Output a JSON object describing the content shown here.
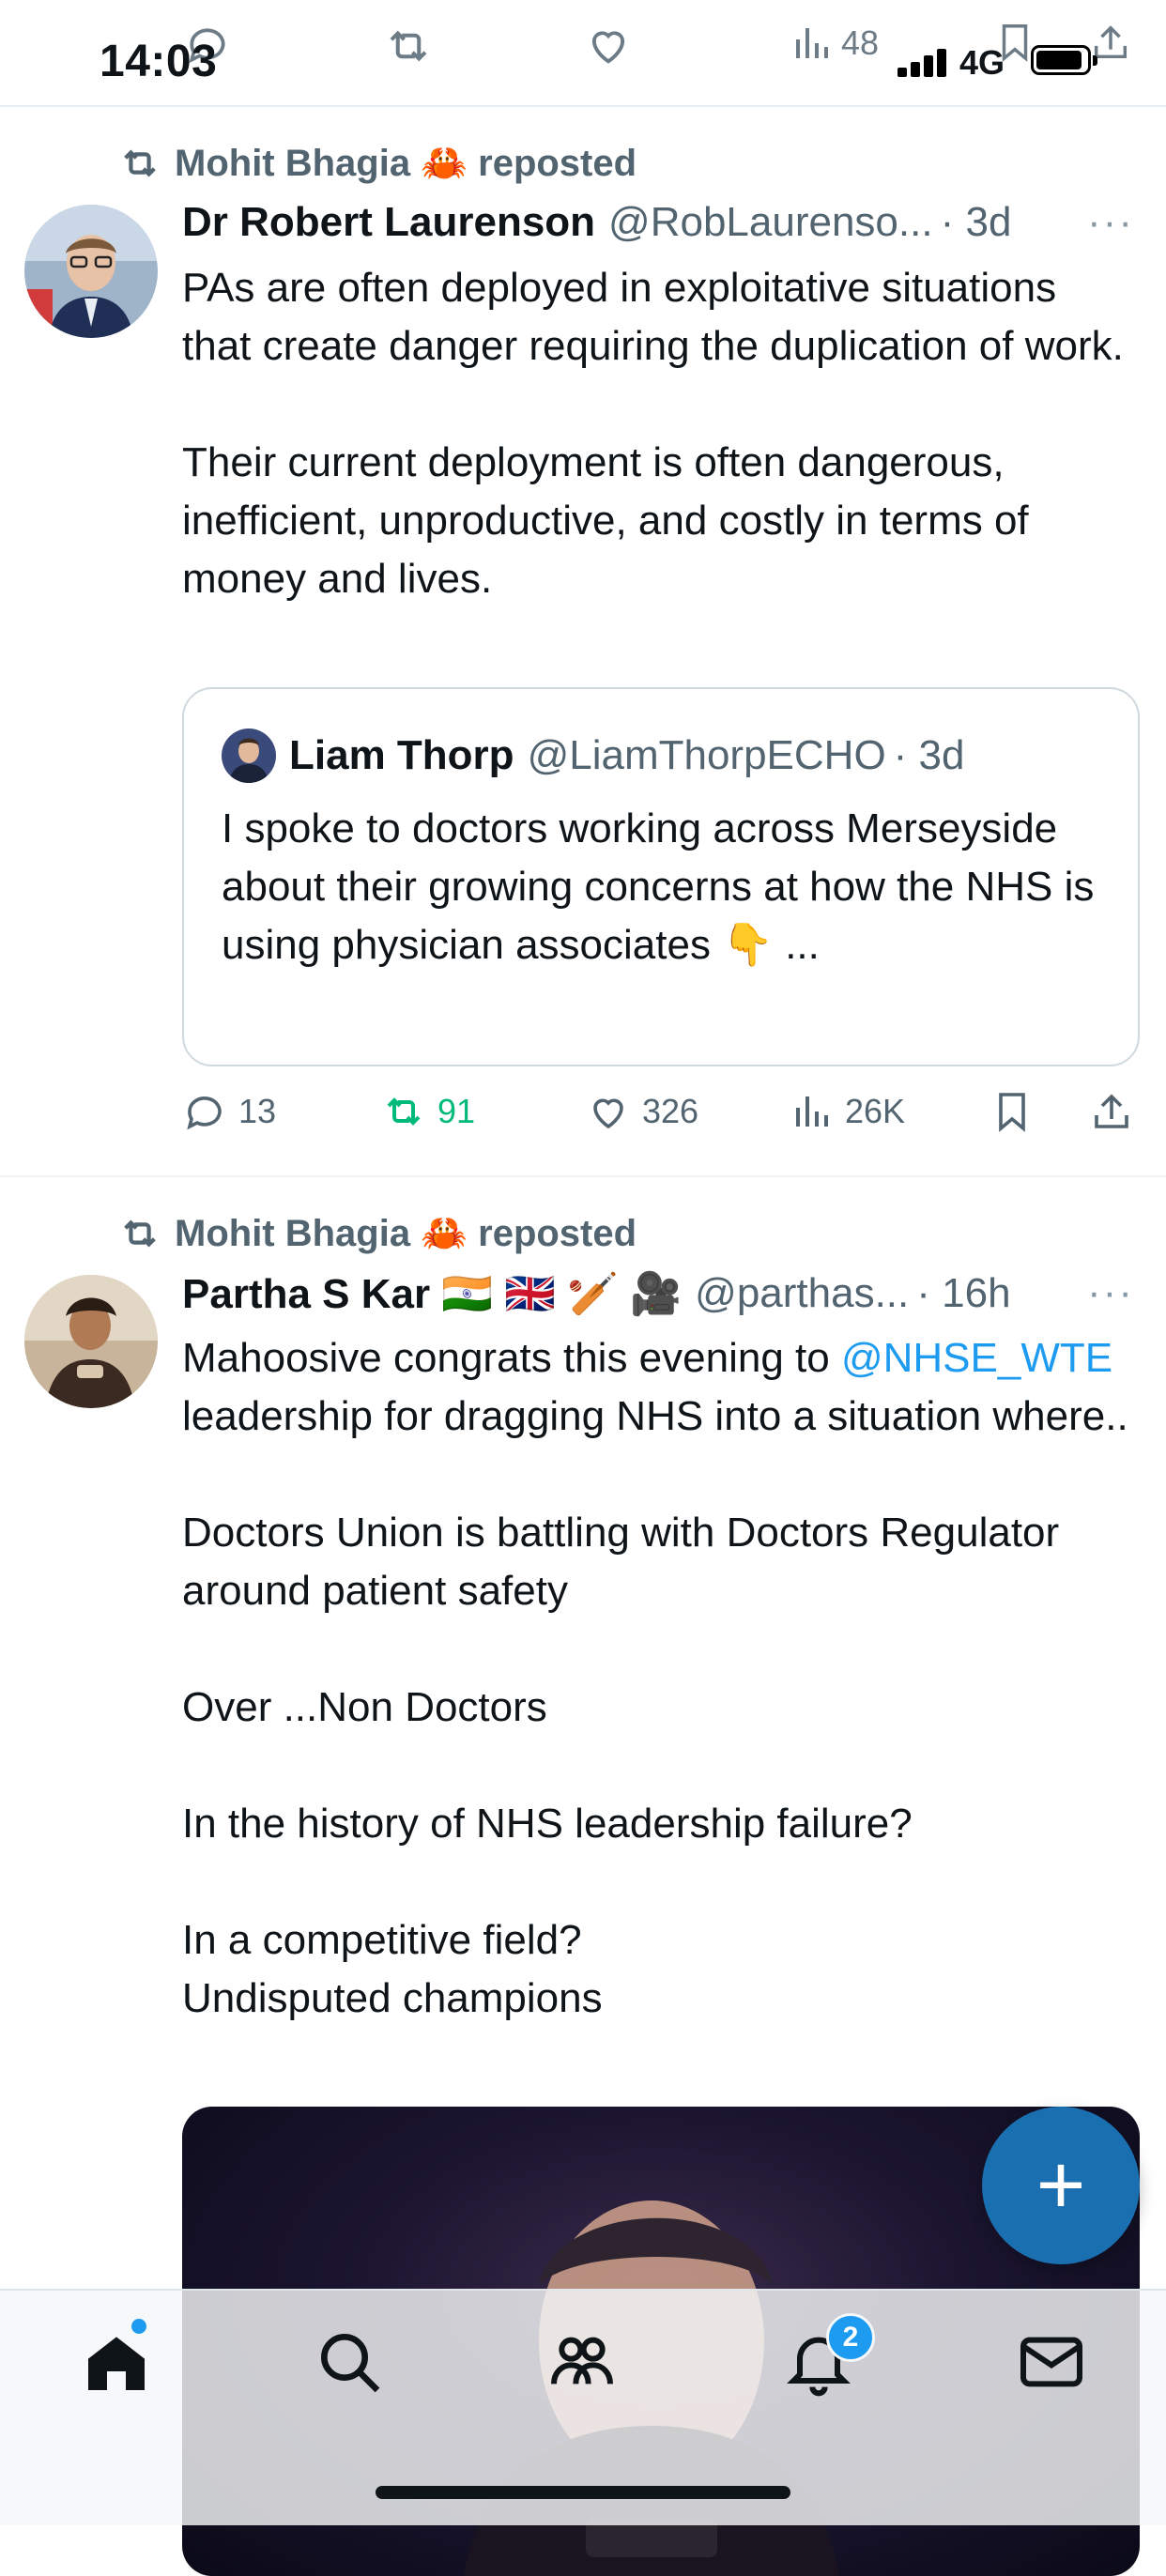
{
  "status_bar": {
    "time": "14:03",
    "network": "4G"
  },
  "header_ghost": {
    "views": "48"
  },
  "tweets": [
    {
      "reposted_by": "Mohit Bhagia 🦀 reposted",
      "name": "Dr Robert Laurenson",
      "handle": "@RobLaurenso...",
      "time": "· 3d",
      "more": "···",
      "body": [
        "PAs are often deployed in exploitative situations that create danger requiring the duplication of work.",
        "Their current deployment is often dangerous, inefficient, unproductive, and costly in terms of money and lives."
      ],
      "quote": {
        "name": "Liam Thorp",
        "handle": "@LiamThorpECHO",
        "time": "· 3d",
        "body": "I spoke to doctors working across Merseyside about their growing concerns at how the NHS is using physician associates 👇 ..."
      },
      "actions": {
        "replies": "13",
        "reposts": "91",
        "likes": "326",
        "views": "26K"
      }
    },
    {
      "reposted_by": "Mohit Bhagia 🦀 reposted",
      "name": "Partha S Kar 🇮🇳 🇬🇧 🏏 🎥",
      "handle": "@parthas...",
      "time": "· 16h",
      "more": "···",
      "body_link": "@NHSE_WTE",
      "body_first_pre": "Mahoosive congrats this evening to",
      "body_first_post": "leadership for dragging NHS into a situation where..",
      "body": [
        "Doctors Union is battling with Doctors Regulator around patient safety",
        "Over ...Non Doctors",
        "In the history of NHS leadership failure?",
        "In a competitive field?",
        "Undisputed champions"
      ]
    }
  ],
  "fab": {
    "label": "+"
  },
  "bottom_nav": {
    "notifications_badge": "2"
  },
  "colors": {
    "accent": "#1d9bf0",
    "repost_green": "#00ba7c",
    "muted": "#536471"
  }
}
